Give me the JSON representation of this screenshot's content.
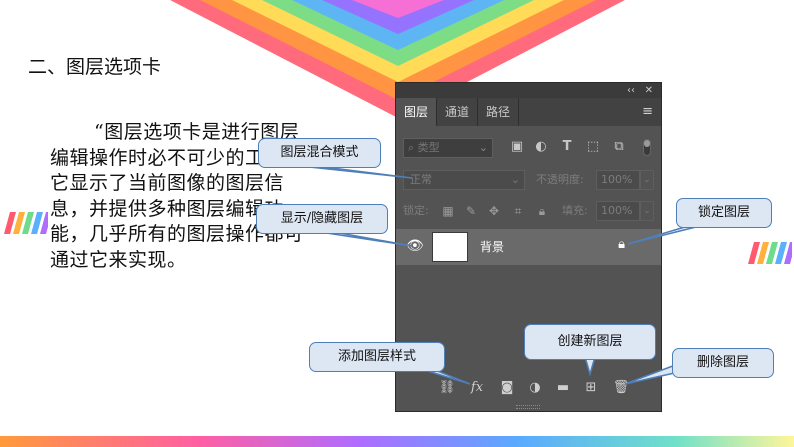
{
  "slide": {
    "section_title": "二、图层选项卡",
    "paragraph": "“图层选项卡是进行图层编辑操作时必不可少的工具，它显示了当前图像的图层信息，并提供多种图层编辑功能，几乎所有的图层操作都可通过它来实现。"
  },
  "panel": {
    "collapse_label": "‹‹",
    "close_label": "✕",
    "tabs": [
      {
        "label": "图层",
        "active": true
      },
      {
        "label": "通道",
        "active": false
      },
      {
        "label": "路径",
        "active": false
      }
    ],
    "menu_icon": "≡",
    "filter": {
      "search_placeholder": "类型",
      "icons": [
        "image-filter-icon",
        "adjustment-filter-icon",
        "type-filter-icon",
        "shape-filter-icon",
        "smart-object-filter-icon"
      ]
    },
    "blend_mode": "正常",
    "opacity_label": "不透明度:",
    "opacity_value": "100%",
    "lock_label": "锁定:",
    "fill_label": "填充:",
    "fill_value": "100%",
    "layer": {
      "name": "背景"
    }
  },
  "callouts": {
    "blend_mode": "图层混合模式",
    "visibility": "显示/隐藏图层",
    "lock": "锁定图层",
    "add_style": "添加图层样式",
    "new_layer": "创建新图层",
    "delete_layer": "删除图层"
  },
  "colors": {
    "panel_bg": "#535353",
    "callout_bg": "#dde6f3",
    "callout_border": "#4f7fb8"
  }
}
